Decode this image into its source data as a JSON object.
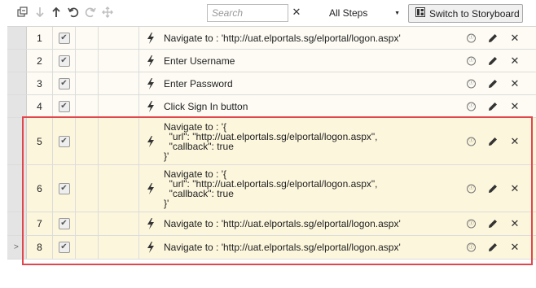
{
  "toolbar": {
    "icons": [
      "expand-collapse-icon",
      "move-down-icon",
      "move-up-icon",
      "undo-icon",
      "redo-icon",
      "move-icon"
    ],
    "search_placeholder": "Search",
    "clear_glyph": "✕",
    "filter_value": "All Steps",
    "storyboard_label": "Switch to Storyboard"
  },
  "steps": [
    {
      "num": "1",
      "checked": true,
      "desc": "Navigate to : 'http://uat.elportals.sg/elportal/logon.aspx'"
    },
    {
      "num": "2",
      "checked": true,
      "desc": "Enter Username"
    },
    {
      "num": "3",
      "checked": true,
      "desc": "Enter Password"
    },
    {
      "num": "4",
      "checked": true,
      "desc": "Click Sign In button"
    },
    {
      "num": "5",
      "checked": true,
      "desc": "Navigate to : '{\n  \"url\": \"http://uat.elportals.sg/elportal/logon.aspx\",\n  \"callback\": true\n}'"
    },
    {
      "num": "6",
      "checked": true,
      "desc": "Navigate to : '{\n  \"url\": \"http://uat.elportals.sg/elportal/logon.aspx\",\n  \"callback\": true\n}'"
    },
    {
      "num": "7",
      "checked": true,
      "desc": "Navigate to : 'http://uat.elportals.sg/elportal/logon.aspx'"
    },
    {
      "num": "8",
      "checked": true,
      "desc": "Navigate to : 'http://uat.elportals.sg/elportal/logon.aspx'"
    }
  ],
  "colors": {
    "highlight_border": "#e2464d",
    "highlight_row": "#fcf6dc",
    "row_bg": "#fdfbf3"
  }
}
